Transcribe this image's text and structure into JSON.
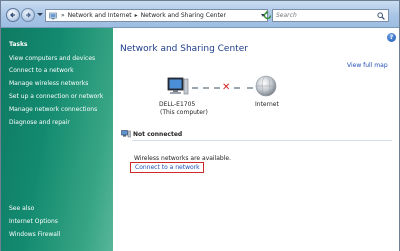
{
  "address_bar": {
    "crumbs": [
      "Network and Internet",
      "Network and Sharing Center"
    ]
  },
  "search": {
    "placeholder": "Search"
  },
  "task_pane": {
    "heading": "Tasks",
    "links": [
      "View computers and devices",
      "Connect to a network",
      "Manage wireless networks",
      "Set up a connection or network",
      "Manage network connections",
      "Diagnose and repair"
    ],
    "see_also_heading": "See also",
    "see_also_links": [
      "Internet Options",
      "Windows Firewall"
    ]
  },
  "main": {
    "title": "Network and Sharing Center",
    "view_full_map": "View full map",
    "computer_name": "DELL-E1705",
    "computer_sub": "(This computer)",
    "internet_label": "Internet",
    "status": "Not connected",
    "wireless_message": "Wireless networks are available.",
    "connect_link": "Connect to a network"
  },
  "colors": {
    "title_blue": "#1e3e8c",
    "link_blue": "#1f4fb6",
    "pane_green": "#138a70",
    "disconnect_red": "#d41f1f"
  },
  "icons": [
    "back-icon",
    "forward-icon",
    "network-folder-icon",
    "refresh-icon",
    "search-icon",
    "help-icon",
    "computer-icon",
    "globe-icon",
    "disconnected-x-icon",
    "status-network-icon"
  ]
}
